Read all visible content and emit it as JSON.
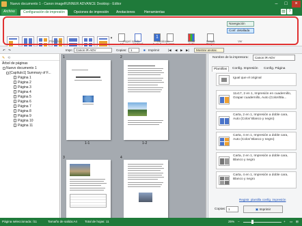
{
  "window": {
    "title": "Nuevo documento 1 - Canon imageRUNNER ADVANCE Desktop - Editor",
    "file_button": "Archivo",
    "controls": [
      "–",
      "□",
      "×"
    ]
  },
  "tabs": [
    "Configuración de impresión",
    "Opciones de impresión",
    "Anotaciones",
    "Herramientas"
  ],
  "ribbon": {
    "labels": {
      "plantillas": "Plantillas",
      "papel": "Papel salida",
      "acabado": "Acabado",
      "color": "Color",
      "grapa": "Grapa",
      "ver": "Ver"
    },
    "paper_size": "A4",
    "orientation": "Vertical",
    "pages_per_sheet": "1 en 1",
    "duplex": "1 cara",
    "color_mode": "Auto",
    "staple": "Grapa",
    "navigation": "Navegación",
    "detailed_config": "Conf. detallada"
  },
  "toolbar": {
    "printer_label": "Impr.:",
    "printer_value": "Canon iR-ADV",
    "copies_label": "Copias:",
    "copies_value": "1",
    "print_label": "Imprimir",
    "show_annotations": "Mostrar anotac."
  },
  "tree": {
    "header": "Árbol de páginas",
    "root": "Nuevo documento 1",
    "chapter": "[Capítulo1] Summary of F...",
    "pages": [
      "Página 1",
      "Página 2",
      "Página 3",
      "Página 4",
      "Página 5",
      "Página 6",
      "Página 7",
      "Página 8",
      "Página 9",
      "Página 10",
      "Página 11"
    ]
  },
  "preview": {
    "page_numbers": [
      "1",
      "2",
      "3",
      "4"
    ],
    "labels": [
      "1-1",
      "1-2"
    ]
  },
  "right_panel": {
    "printer_name_label": "Nombre de la impresora:",
    "printer_name_value": "Canon iR-ADV",
    "tabs": [
      "Plantillas",
      "Config. Impresión",
      "Config. Página"
    ],
    "templates": [
      "Igual que el original",
      "11x17, 2 en 1, Impresión en cuadernillo, Grapar cuadernillo, Auto (Color/Bla...",
      "Carta, 2 en 1, Impresión a doble cara, Auto (Color/ Blanco y negro)",
      "Carta, 4 en 1, Impresión a doble cara, Auto (Color/ Blanco y negro)",
      "Carta, 2 en 1, Impresión a doble cara, Blanco y negro",
      "Carta, 4 en 1, Impresión a doble cara, Blanco y negro"
    ],
    "register_link": "Registr. plantilla config. impresión",
    "copies_label": "Copias:",
    "copies_value": "1",
    "print_button": "Imprimir"
  },
  "status": {
    "selected": "Página seleccionada: /11",
    "output_size": "Tamaño de salida:A4",
    "total_sheets": "Total de hojas: 11",
    "zoom": "25%"
  },
  "colors": {
    "brand_green": "#1f7a3a",
    "highlight_red": "#e03030"
  }
}
